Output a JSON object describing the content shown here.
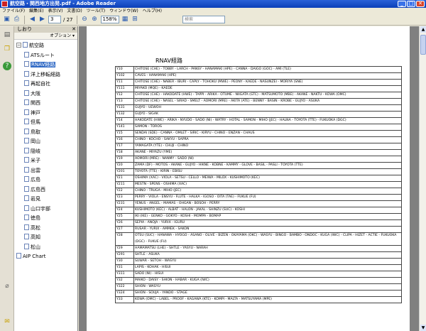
{
  "window": {
    "title": "航空路・関西地方出発.pdf - Adobe Reader",
    "min_glyph": "_",
    "max_glyph": "□",
    "close_glyph": "✕"
  },
  "menu": [
    "ファイル(F)",
    "編集(E)",
    "表示(V)",
    "文書(D)",
    "ツール(T)",
    "ウィンドウ(W)",
    "ヘルプ(H)"
  ],
  "toolbar": {
    "page_current": "3",
    "page_total": "/ 27",
    "zoom": "158%",
    "search_placeholder": "検索"
  },
  "bookmarks": {
    "title": "しおり",
    "options": "オプション ▾",
    "close": "✕",
    "root": {
      "label": "航空路",
      "expander": "−"
    },
    "items": [
      {
        "label": "ATSルート"
      },
      {
        "label": "RNAV経路",
        "selected": true
      },
      {
        "label": "洋上移転経路"
      },
      {
        "label": "再起自社"
      },
      {
        "label": "大阪"
      },
      {
        "label": "関西"
      },
      {
        "label": "神戸"
      },
      {
        "label": "但馬"
      },
      {
        "label": "鳥取"
      },
      {
        "label": "岡山"
      },
      {
        "label": "隠岐"
      },
      {
        "label": "米子"
      },
      {
        "label": "出雲"
      },
      {
        "label": "広島"
      },
      {
        "label": "広島西"
      },
      {
        "label": "岩見"
      },
      {
        "label": "山口宇部"
      },
      {
        "label": "徳島"
      },
      {
        "label": "高松"
      },
      {
        "label": "高知"
      },
      {
        "label": "松山"
      }
    ],
    "second_root": {
      "label": "AIP Chart"
    }
  },
  "document": {
    "heading": "RNAV経路",
    "routes": [
      {
        "id": "Y10",
        "path": "CHITOSE (CHE) - TOBBY - LARCH - PANSY - HANAMAKI (HPE) - CANNA - DAIGO (GOC) - AMI (TLE)"
      },
      {
        "id": "Y102",
        "path": "CAVES - HANAMAKI (HPE)"
      },
      {
        "id": "Y11",
        "path": "CHITOSE (CHE) - NABER - IBURI - CAPLY - TOHOKU (MWE) - PEONY - KAEDE - NASUNZEI - MORIYA (SNE)"
      },
      {
        "id": "Y111",
        "path": "MIYAKO (MQE) - KAEDE"
      },
      {
        "id": "Y12",
        "path": "CHITOSE (CHE) - HAKODATE (HWE) - TAPPI - ARIKA - OTUME - NIIGATA (GTC) - MATSUMOTO (MBE) - AKANE - NAKTU - KOWA (OMC)"
      },
      {
        "id": "Y13",
        "path": "CHITOSE (CHE) - NASEL - SIRAD - SMELT - AOMORI (MRE) - AKITA (ATE) - BENNY - BASIN - KROBE - GUJYO - ASUKA"
      },
      {
        "id": "Y131",
        "path": "GUJYO - UEWOH"
      },
      {
        "id": "Y132",
        "path": "GUJYO - SIGAK"
      },
      {
        "id": "Y14",
        "path": "HAKODATE (HWE) - ARIKA - NYUDO - SADO (NI) - WATRY - HOTAL - SAMON - MIHO (JEC) - HALNA - TOYOTA (TTE) - FUKUOKA (DGC)"
      },
      {
        "id": "Y141",
        "path": "SAMON - TOROS"
      },
      {
        "id": "Y15",
        "path": "SENDAI (SDE) - CANNA - OMLET - SIRIC - KIRYU - CHINO - ENZAN - CHAUS"
      },
      {
        "id": "Y16",
        "path": "CHINO - KOCHO - SAKYU - SAPRA"
      },
      {
        "id": "Y17",
        "path": "YAMAGATA (YTE) - CHUJI - CHINO"
      },
      {
        "id": "Y18",
        "path": "AKANE - MIYAZU (YME)"
      },
      {
        "id": "Y19",
        "path": "AOMORI (MRE) - NANMY - SADO (NI)"
      },
      {
        "id": "Y20",
        "path": "ZAMA (DF) - MOTOS - AKANE - GUJYO - HIKNE - KOBNE - KAMMY - GLOVE - BASIL - PASLI - TOYOTA (TTE)"
      },
      {
        "id": "Y201",
        "path": "TOYOTA (TTE) - KIRIN - EBISU"
      },
      {
        "id": "Y21",
        "path": "OSHIMA (XAC) - VIOLA - SETSU - CELLO - MEIWA - MILOX - KUSHIMOTO (KEC)"
      },
      {
        "id": "Y211",
        "path": "MESTN - SPENS - OSHIMA (XAC)"
      },
      {
        "id": "Y22",
        "path": "CHINO - TRUGA - MIHO (JEC)"
      },
      {
        "id": "Y23",
        "path": "PERRY - VIOLA - ENSYU - FLUTE - HALKA - IGOSO - OITA (TAE) - FUKUE (FU)"
      },
      {
        "id": "Y231",
        "path": "YENUS - ANGEL - MAMAS - OHGAN - BOSOH - PERRY"
      },
      {
        "id": "Y24",
        "path": "KUSHIMOTO (KEC) - ALBAT - HALON - JAKAL - SHINZU (SUC) - KOSHI"
      },
      {
        "id": "Y25",
        "path": "IKI (IKE) - GENKO - GOKYO - KOSHI - MOMPA - BOMAP"
      },
      {
        "id": "Y26",
        "path": "SEPIA - ANOJA - YURIX - IGURU"
      },
      {
        "id": "Y27",
        "path": "RUSAR - YURIX - AMMEK - SAKON"
      },
      {
        "id": "Y28",
        "path": "OTSU (SUC) - HANAWA - HYOGO - ASANO - OLIVE - BIZEN - OKAYAMA (OKC) - WASYU - BINGO - BAMBO - ONDOC - KUGA (IWC) - CLIPA - HIZET - ACTIE - FUKUOKA (DGC) - FUKUE (FU)",
        "tall": true
      },
      {
        "id": "Y29",
        "path": "HAMAMATSU (LHE) - SHTLE - YASYU - NARAH"
      },
      {
        "id": "Y291",
        "path": "SHTLE - ASUKA"
      },
      {
        "id": "Y30",
        "path": "SUWAR - SETOH - WASYU"
      },
      {
        "id": "Y31",
        "path": "LAPIS - KOHAK - HISUI"
      },
      {
        "id": "Y311",
        "path": "SADO (NI) - HISUI"
      },
      {
        "id": "Y32",
        "path": "MAIKO - DAISY - SHION - HABAR - KUGA (IWC)"
      },
      {
        "id": "Y322",
        "path": "SHION - WASYU"
      },
      {
        "id": "Y324",
        "path": "SHION - SOUJA - YANDO - STAGE"
      },
      {
        "id": "Y33",
        "path": "KOWA (OMC) - LABEL - PROOF - KAGAWA (KTE) - KOMPI - MALTA - MATSUYAMA (MPE)"
      }
    ]
  }
}
